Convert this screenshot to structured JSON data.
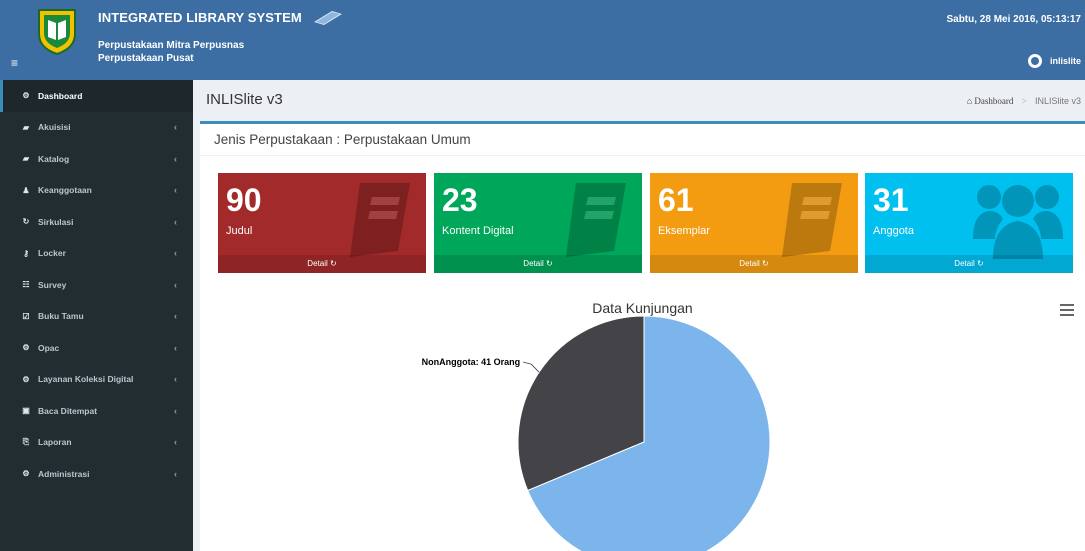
{
  "header": {
    "app_title": "INTEGRATED LIBRARY SYSTEM",
    "sub1": "Perpustakaan Mitra Perpusnas",
    "sub2": "Perpustakaan Pusat",
    "datetime": "Sabtu, 28 Mei 2016, 05:13:17",
    "username": "inlislite",
    "toggle_icon": "≡"
  },
  "sidebar": {
    "items": [
      {
        "label": "Dashboard",
        "icon": "dashboard-icon",
        "glyph": "⚙"
      },
      {
        "label": "Akuisisi",
        "icon": "book-icon",
        "glyph": "▰"
      },
      {
        "label": "Katalog",
        "icon": "book-icon",
        "glyph": "▰"
      },
      {
        "label": "Keanggotaan",
        "icon": "user-icon",
        "glyph": "♟"
      },
      {
        "label": "Sirkulasi",
        "icon": "refresh-icon",
        "glyph": "↻"
      },
      {
        "label": "Locker",
        "icon": "key-icon",
        "glyph": "⚷"
      },
      {
        "label": "Survey",
        "icon": "users-icon",
        "glyph": "☷"
      },
      {
        "label": "Buku Tamu",
        "icon": "check-square-icon",
        "glyph": "☑"
      },
      {
        "label": "Opac",
        "icon": "cogs-icon",
        "glyph": "⚙"
      },
      {
        "label": "Layanan Koleksi Digital",
        "icon": "cogs-icon",
        "glyph": "⚙"
      },
      {
        "label": "Baca Ditempat",
        "icon": "book-square-icon",
        "glyph": "▣"
      },
      {
        "label": "Laporan",
        "icon": "report-icon",
        "glyph": "⎘"
      },
      {
        "label": "Administrasi",
        "icon": "cogs-icon",
        "glyph": "⚙"
      }
    ],
    "chevron": "‹"
  },
  "content_header": {
    "title": "INLISlite v3",
    "crumb_home": "Dashboard",
    "crumb_sep": ">",
    "crumb_current": "INLISlite v3",
    "home_glyph": "⌂"
  },
  "box": {
    "title": "Jenis Perpustakaan : Perpustakaan Umum"
  },
  "tiles": [
    {
      "number": "90",
      "label": "Judul",
      "footer": "Detail ↻",
      "color": "#a32a2a",
      "icon": "book-icon"
    },
    {
      "number": "23",
      "label": "Kontent Digital",
      "footer": "Detail ↻",
      "color": "#00a65a",
      "icon": "book-icon"
    },
    {
      "number": "61",
      "label": "Eksemplar",
      "footer": "Detail ↻",
      "color": "#f39c12",
      "icon": "book-icon"
    },
    {
      "number": "31",
      "label": "Anggota",
      "footer": "Detail ↻",
      "color": "#00c0ef",
      "icon": "users-icon"
    }
  ],
  "chart_data": {
    "type": "pie",
    "title": "Data Kunjungan",
    "slices": [
      {
        "label": "NonAnggota: 41 Orang",
        "value": 41,
        "color": "#434348"
      },
      {
        "label": "",
        "value": 90,
        "color": "#7cb5ec"
      }
    ]
  }
}
